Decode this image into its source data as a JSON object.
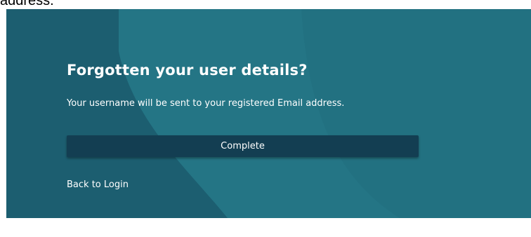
{
  "page": {
    "top_text": "address."
  },
  "form": {
    "title": "Forgotten your user details?",
    "description": "Your username will be sent to your registered Email address.",
    "complete_label": "Complete",
    "back_link_label": "Back to Login"
  },
  "colors": {
    "panel_background": "#1e6a7a",
    "button_background": "#133e52",
    "text": "#ffffff"
  }
}
